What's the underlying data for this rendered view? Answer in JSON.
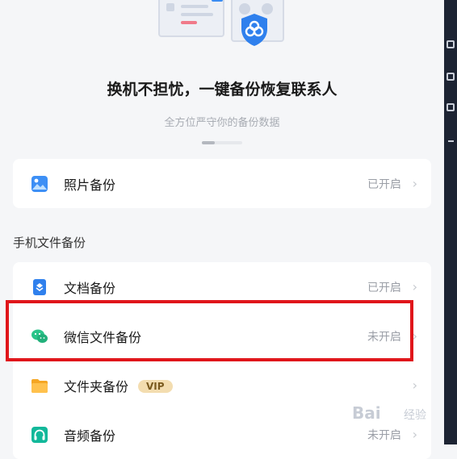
{
  "hero": {
    "title": "换机不担忧，一键备份恢复联系人",
    "subtitle": "全方位严守你的备份数据",
    "carousel": {
      "pages": 3,
      "active_index": 0
    }
  },
  "top_group": [
    {
      "label": "照片备份",
      "status": "已开启",
      "icon": "photo-icon"
    }
  ],
  "phone_section": {
    "heading": "手机文件备份",
    "items": [
      {
        "label": "文档备份",
        "status": "已开启",
        "icon": "document-icon"
      },
      {
        "label": "微信文件备份",
        "status": "未开启",
        "icon": "wechat-icon"
      },
      {
        "label": "文件夹备份",
        "status": "",
        "badge": "VIP",
        "icon": "folder-icon"
      },
      {
        "label": "音频备份",
        "status": "未开启",
        "icon": "headphones-icon"
      }
    ]
  },
  "chevron": "›",
  "colors": {
    "highlight": "#e0161b",
    "accent": "#2f80ed",
    "wechat": "#2bc48a",
    "folder": "#f5a623",
    "audio": "#12b89a",
    "vip_bg": "#f3ddb0"
  },
  "watermark": {
    "text": "Bai",
    "sub": "经验"
  }
}
